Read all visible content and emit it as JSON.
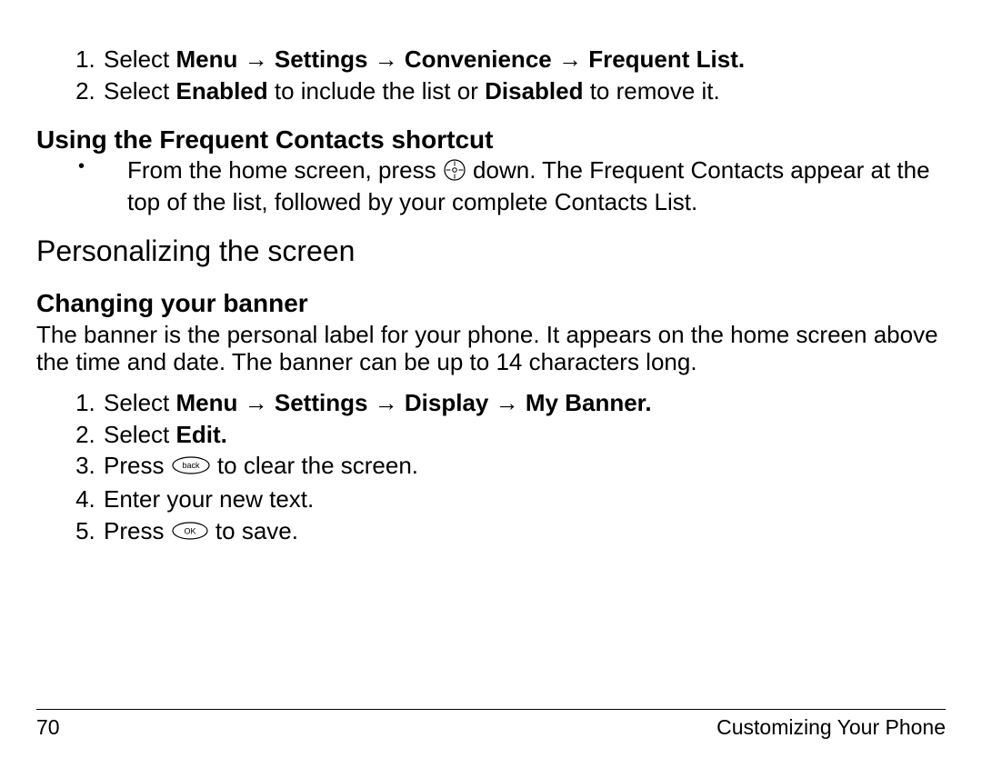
{
  "steps_top": [
    {
      "prefix": "Select ",
      "boldParts": [
        "Menu",
        "Settings",
        "Convenience",
        "Frequent List."
      ],
      "type": "menu-path"
    },
    {
      "prefix": "Select ",
      "bold1": "Enabled",
      "mid": " to include the list or ",
      "bold2": "Disabled",
      "suffix": " to remove it.",
      "type": "enable-disable"
    }
  ],
  "subhead1": "Using the Frequent Contacts shortcut",
  "freq_shortcut": {
    "before": "From the home screen, press ",
    "after": " down. The Frequent Contacts appear at the top of the list, followed by your complete Contacts List."
  },
  "section2": "Personalizing the screen",
  "subhead2": "Changing your banner",
  "banner_body": "The banner is the personal label for your phone. It appears on the home screen above the time and date. The banner can be up to 14 characters long.",
  "steps_banner": {
    "s1_prefix": "Select ",
    "s1_parts": [
      "Menu",
      "Settings",
      "Display",
      "My Banner."
    ],
    "s2_prefix": "Select ",
    "s2_bold": "Edit.",
    "s3_before": "Press ",
    "s3_after": " to clear the screen.",
    "s4": "Enter your new text.",
    "s5_before": "Press ",
    "s5_after": " to save."
  },
  "icons": {
    "arrow": "→",
    "back_label": "back",
    "ok_label": "OK"
  },
  "footer": {
    "page": "70",
    "chapter": "Customizing Your Phone"
  }
}
